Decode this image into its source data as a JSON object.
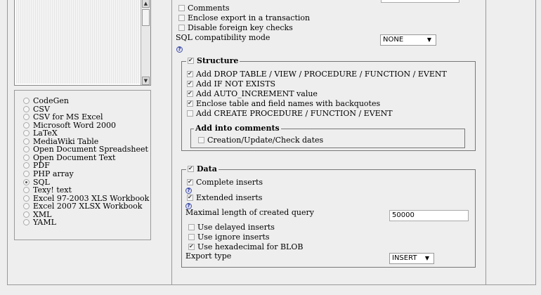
{
  "formats": {
    "items": [
      {
        "label": "CodeGen",
        "selected": false
      },
      {
        "label": "CSV",
        "selected": false
      },
      {
        "label": "CSV for MS Excel",
        "selected": false
      },
      {
        "label": "Microsoft Word 2000",
        "selected": false
      },
      {
        "label": "LaTeX",
        "selected": false
      },
      {
        "label": "MediaWiki Table",
        "selected": false
      },
      {
        "label": "Open Document Spreadsheet",
        "selected": false
      },
      {
        "label": "Open Document Text",
        "selected": false
      },
      {
        "label": "PDF",
        "selected": false
      },
      {
        "label": "PHP array",
        "selected": false
      },
      {
        "label": "SQL",
        "selected": true
      },
      {
        "label": "Texy! text",
        "selected": false
      },
      {
        "label": "Excel 97-2003 XLS Workbook",
        "selected": false
      },
      {
        "label": "Excel 2007 XLSX Workbook",
        "selected": false
      },
      {
        "label": "XML",
        "selected": false
      },
      {
        "label": "YAML",
        "selected": false
      }
    ]
  },
  "top_options": {
    "comments": {
      "label": "Comments",
      "checked": false
    },
    "transaction": {
      "label": "Enclose export in a transaction",
      "checked": false
    },
    "foreign_keys": {
      "label": "Disable foreign key checks",
      "checked": false
    },
    "compat_label": "SQL compatibility mode",
    "compat_value": "NONE"
  },
  "structure": {
    "legend": "Structure",
    "checked": true,
    "options": [
      {
        "label": "Add DROP TABLE / VIEW / PROCEDURE / FUNCTION / EVENT",
        "checked": true
      },
      {
        "label": "Add IF NOT EXISTS",
        "checked": true
      },
      {
        "label": "Add AUTO_INCREMENT value",
        "checked": true
      },
      {
        "label": "Enclose table and field names with backquotes",
        "checked": true
      },
      {
        "label": "Add CREATE PROCEDURE / FUNCTION / EVENT",
        "checked": false
      }
    ],
    "comments_legend": "Add into comments",
    "comments_option": {
      "label": "Creation/Update/Check dates",
      "checked": false
    }
  },
  "data": {
    "legend": "Data",
    "checked": true,
    "complete_inserts": {
      "label": "Complete inserts",
      "checked": true
    },
    "extended_inserts": {
      "label": "Extended inserts",
      "checked": true
    },
    "max_length_label": "Maximal length of created query",
    "max_length_value": "50000",
    "delayed": {
      "label": "Use delayed inserts",
      "checked": false
    },
    "ignore": {
      "label": "Use ignore inserts",
      "checked": false
    },
    "hex_blob": {
      "label": "Use hexadecimal for BLOB",
      "checked": true
    },
    "export_type_label": "Export type",
    "export_type_value": "INSERT"
  },
  "help_icon": "question-mark-icon"
}
